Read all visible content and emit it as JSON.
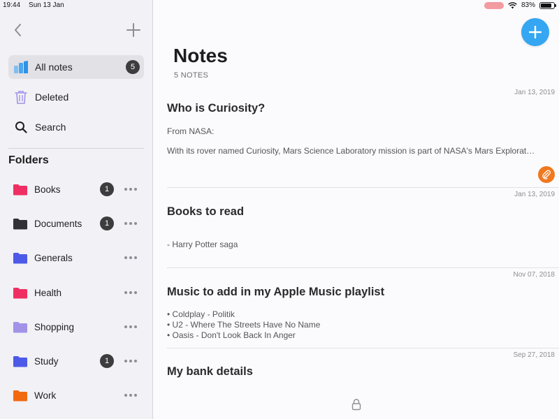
{
  "status_bar": {
    "time": "19:44",
    "date": "Sun 13 Jan",
    "battery": "83%",
    "battery_level": 0.83
  },
  "sidebar": {
    "nav": [
      {
        "label": "All notes",
        "count": "5",
        "icon": "notes-stack-icon"
      },
      {
        "label": "Deleted",
        "icon": "trash-icon"
      },
      {
        "label": "Search",
        "icon": "search-icon"
      }
    ],
    "folders_heading": "Folders",
    "folders": [
      {
        "name": "Books",
        "count": "1",
        "color": "#ef2f63"
      },
      {
        "name": "Documents",
        "count": "1",
        "color": "#333335"
      },
      {
        "name": "Generals",
        "count": "",
        "color": "#4d5ae8"
      },
      {
        "name": "Health",
        "count": "",
        "color": "#ef2f63"
      },
      {
        "name": "Shopping",
        "count": "",
        "color": "#a293e8"
      },
      {
        "name": "Study",
        "count": "1",
        "color": "#4d5ae8"
      },
      {
        "name": "Work",
        "count": "",
        "color": "#f26a10"
      }
    ]
  },
  "main": {
    "title": "Notes",
    "subtitle": "5 NOTES",
    "notes": [
      {
        "date": "Jan 13, 2019",
        "title": "Who is Curiosity?",
        "lines": [
          "From NASA:",
          "With its rover named Curiosity, Mars Science Laboratory mission is part of NASA's Mars Explorat…"
        ],
        "has_attachment": true
      },
      {
        "date": "Jan 13, 2019",
        "title": "Books to read",
        "lines": [
          "- Harry Potter saga"
        ]
      },
      {
        "date": "Nov 07, 2018",
        "title": "Music to add in my Apple Music playlist",
        "lines": [
          "• Coldplay - Politik",
          "• U2 - Where The Streets Have No Name",
          "• Oasis - Don't Look Back In Anger"
        ]
      },
      {
        "date": "Sep 27, 2018",
        "title": "My bank details",
        "locked": true
      }
    ]
  },
  "colors": {
    "accent": "#34a6f2",
    "attachment": "#f0781f",
    "badge": "#3c3c3e"
  }
}
